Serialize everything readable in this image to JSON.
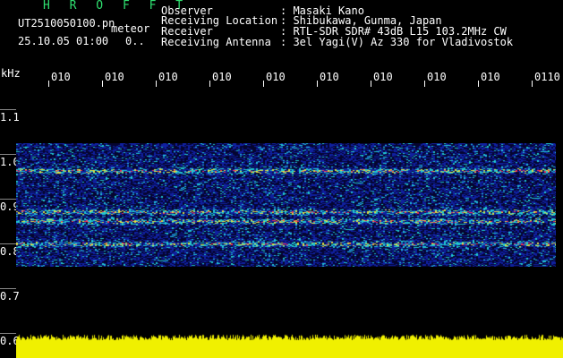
{
  "header": {
    "station": "H R O F F T",
    "file_name": "UT2510050100.pn",
    "file_suffix": "meteor",
    "datetime": "25.10.05 01:00",
    "counter": "0..",
    "fields": [
      {
        "key": "Observer",
        "value": ": Masaki Kano"
      },
      {
        "key": "Receiving Location",
        "value": ": Shibukawa, Gunma, Japan"
      },
      {
        "key": "Receiver",
        "value": ": RTL-SDR SDR# 43dB L15 103.2MHz CW"
      },
      {
        "key": "Receiving Antenna",
        "value": ": 3el Yagi(V) Az 330 for Vladivostok"
      }
    ]
  },
  "time_axis": {
    "labels": [
      "010",
      "010",
      "010",
      "010",
      "010",
      "010",
      "010",
      "010",
      "010",
      "0110"
    ]
  },
  "freq_axis": {
    "unit": "kHz",
    "labels": [
      "1.1",
      "1.0",
      "0.9",
      "0.8",
      "0.7",
      "0.6"
    ]
  },
  "colors": {
    "background": "#000000",
    "text": "#ffffff",
    "station": "#2fe070",
    "noise_low": "#1020a0",
    "noise_mid": "#20c8d0",
    "noise_high": "#ff3050",
    "audio_level": "#f0f000"
  },
  "spectrogram": {
    "band_top_khz": 1.04,
    "band_bottom_khz": 0.77,
    "strong_lines_khz": [
      0.98,
      0.89,
      0.87,
      0.82
    ]
  }
}
